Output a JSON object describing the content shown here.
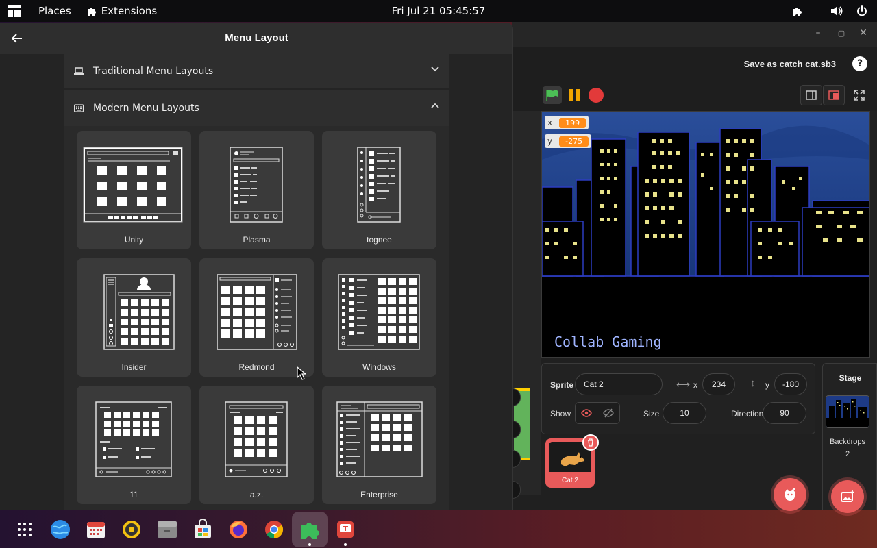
{
  "topbar": {
    "places": "Places",
    "extensions": "Extensions",
    "clock": "Fri Jul 21  05:45:57"
  },
  "menu_window": {
    "title": "Menu Layout",
    "sections": [
      {
        "label": "Traditional Menu Layouts",
        "expanded": false
      },
      {
        "label": "Modern Menu Layouts",
        "expanded": true
      }
    ],
    "layouts": [
      "Unity",
      "Plasma",
      "tognee",
      "Insider",
      "Redmond",
      "Windows",
      "11",
      "a.z.",
      "Enterprise"
    ]
  },
  "scratch": {
    "save_label": "Save as catch cat.sb3",
    "help": "?",
    "monitors": [
      {
        "name": "x",
        "value": "199"
      },
      {
        "name": "y",
        "value": "-275"
      }
    ],
    "stage_caption": "Collab Gaming",
    "sprite_info": {
      "sprite_label": "Sprite",
      "sprite_name": "Cat 2",
      "x_label": "x",
      "x_value": "234",
      "y_label": "y",
      "y_value": "-180",
      "show_label": "Show",
      "size_label": "Size",
      "size_value": "10",
      "direction_label": "Direction",
      "direction_value": "90"
    },
    "sprite_tile": "Cat 2",
    "stage_pane": {
      "title": "Stage",
      "backdrops_label": "Backdrops",
      "backdrops_count": "2"
    }
  },
  "colors": {
    "accent_red": "#e85a5a",
    "scratch_orange": "#ff8c1a",
    "flag_green": "#4cbf56"
  },
  "dock": [
    "app-grid-icon",
    "globe-icon",
    "calendar-icon",
    "rhythmbox-icon",
    "files-icon",
    "software-store-icon",
    "firefox-icon",
    "chrome-icon",
    "extensions-icon",
    "text-editor-icon"
  ]
}
